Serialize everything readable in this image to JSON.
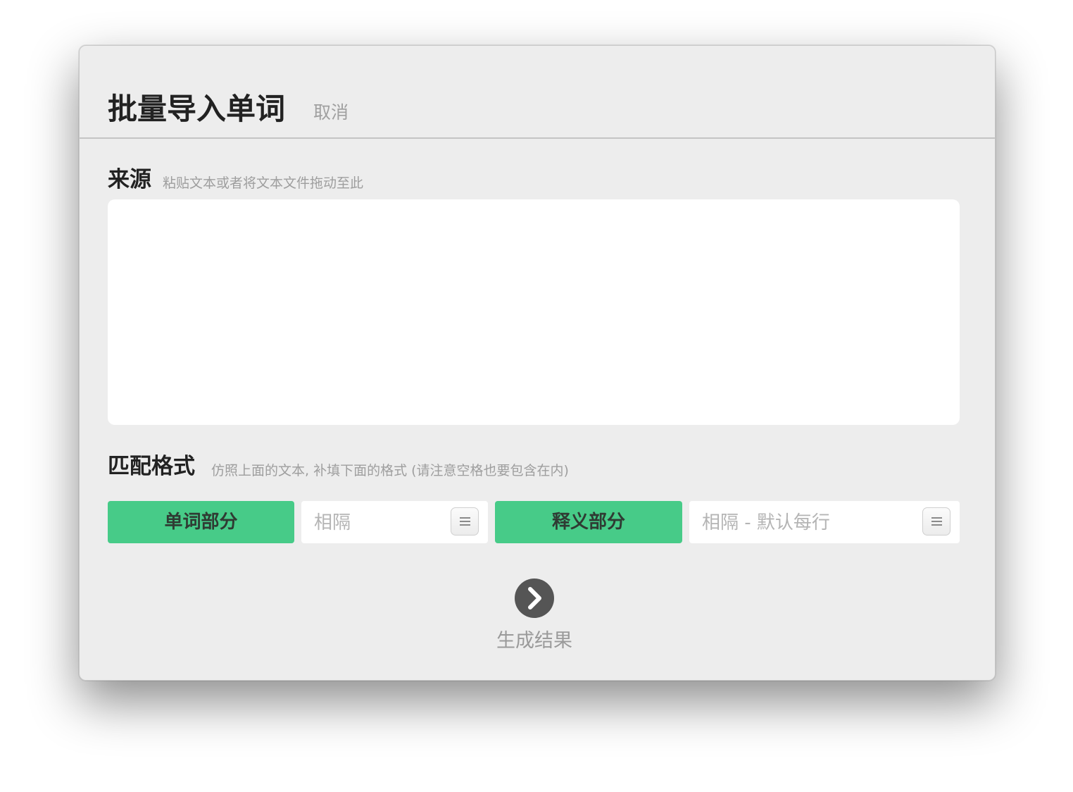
{
  "dialog": {
    "title": "批量导入单词",
    "cancel_label": "取消"
  },
  "source": {
    "label": "来源",
    "hint": "粘贴文本或者将文本文件拖动至此",
    "value": ""
  },
  "format": {
    "label": "匹配格式",
    "hint": "仿照上面的文本, 补填下面的格式 (请注意空格也要包含在内)",
    "word_part_label": "单词部分",
    "separator_1_placeholder": "相隔",
    "meaning_part_label": "释义部分",
    "separator_2_placeholder": "相隔 - 默认每行",
    "menu_icon": "hamburger-menu-icon"
  },
  "action": {
    "generate_label": "生成结果",
    "icon": "chevron-right-circle-icon"
  },
  "colors": {
    "accent_green": "#47cb88",
    "window_bg": "#ededed",
    "go_button": "#555555"
  }
}
